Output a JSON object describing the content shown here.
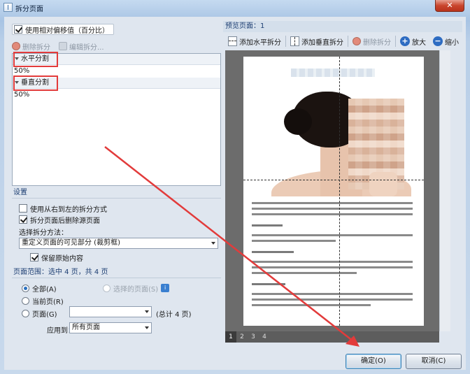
{
  "window": {
    "title": "拆分页面",
    "close_glyph": "✕"
  },
  "left": {
    "use_relative_offset": {
      "label": "使用相对偏移值（百分比）",
      "checked": true
    },
    "toolbar": {
      "delete_label": "删除拆分",
      "edit_label": "编辑拆分..."
    },
    "groups": [
      {
        "label": "水平分割",
        "value": "50%"
      },
      {
        "label": "垂直分割",
        "value": "50%"
      }
    ],
    "settings": {
      "header": "设置",
      "rtl_label": "使用从右到左的拆分方式",
      "rtl_checked": false,
      "delete_source_label": "拆分页面后删除源页面",
      "delete_source_checked": true,
      "method_label": "选择拆分方法：",
      "method_value": "重定义页面的可见部分 (裁剪框)",
      "keep_content_label": "保留原始内容",
      "keep_content_checked": true
    },
    "page_range": {
      "header": "页面范围：选中 4 页，共 4 页",
      "all_label": "全部(A)",
      "selected_label": "选择的页面(S)",
      "current_label": "当前页(R)",
      "pages_label": "页面(G)",
      "pages_value": "",
      "total_label": "(总计 4 页)",
      "apply_to_label": "应用到：",
      "apply_to_value": "所有页面",
      "selected_option": "all"
    }
  },
  "right": {
    "preview_header": "预览页面：1",
    "toolbar": {
      "add_horizontal": "添加水平拆分",
      "add_vertical": "添加垂直拆分",
      "delete": "删除拆分",
      "zoom_in": "放大",
      "zoom_out": "缩小"
    },
    "page_tabs": [
      "1",
      "2",
      "3",
      "4"
    ],
    "active_page": "1"
  },
  "buttons": {
    "ok": "确定(O)",
    "cancel": "取消(C)"
  },
  "colors": {
    "annotation_red": "#e23b3b",
    "accent_blue": "#2e6cc2"
  }
}
